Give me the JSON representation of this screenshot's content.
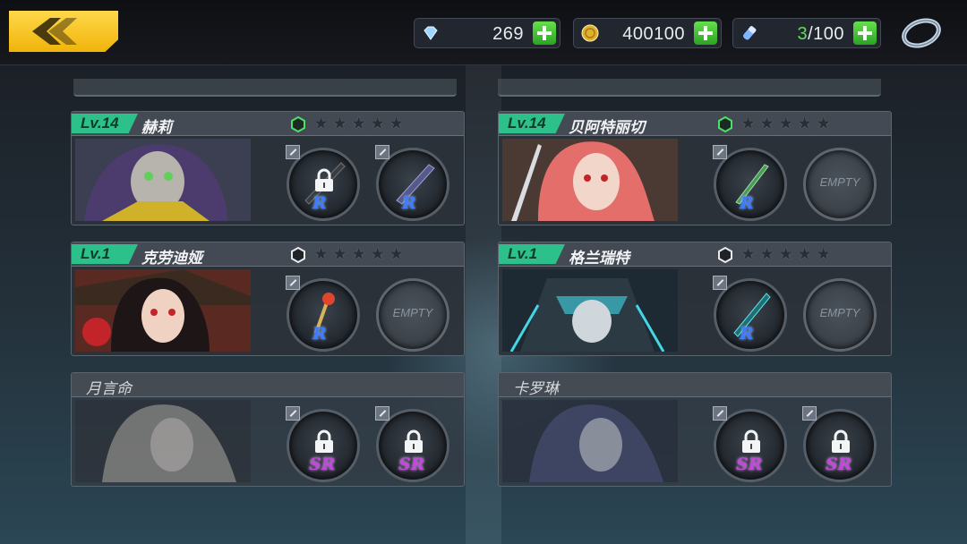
{
  "resources": {
    "gems": {
      "icon": "diamond-icon",
      "value": "269"
    },
    "gold": {
      "icon": "coin-icon",
      "value": "400100"
    },
    "stamina": {
      "icon": "potion-icon",
      "current": "3",
      "max": "/100"
    }
  },
  "colors": {
    "accent": "#f5c21b",
    "level": "#2cc08a",
    "plus": "#3fbf35",
    "rank_r": "#3e7bff",
    "rank_sr": "#c04ad8"
  },
  "cards": [
    {
      "level": "Lv.14",
      "name": "赫莉",
      "grade": "green-hexagon-icon",
      "stars": "★★★★★",
      "slots": [
        {
          "rank": "R",
          "locked": true
        },
        {
          "rank": "R",
          "locked": false
        }
      ]
    },
    {
      "level": "Lv.14",
      "name": "贝阿特丽切",
      "grade": "green-hexagon-icon",
      "stars": "★★★★★",
      "slots": [
        {
          "rank": "R",
          "locked": false
        },
        {
          "empty": "EMPTY"
        }
      ]
    },
    {
      "level": "Lv.1",
      "name": "克劳迪娅",
      "grade": "white-hexagon-icon",
      "stars": "★★★★★",
      "slots": [
        {
          "rank": "R",
          "locked": false
        },
        {
          "empty": "EMPTY"
        }
      ]
    },
    {
      "level": "Lv.1",
      "name": "格兰瑞特",
      "grade": "white-hexagon-icon",
      "stars": "★★★★★",
      "slots": [
        {
          "rank": "R",
          "locked": false
        },
        {
          "empty": "EMPTY"
        }
      ]
    },
    {
      "name": "月言命",
      "slots": [
        {
          "rank": "SR",
          "locked": true
        },
        {
          "rank": "SR",
          "locked": true
        }
      ]
    },
    {
      "name": "卡罗琳",
      "slots": [
        {
          "rank": "SR",
          "locked": true
        },
        {
          "rank": "SR",
          "locked": true
        }
      ]
    }
  ]
}
